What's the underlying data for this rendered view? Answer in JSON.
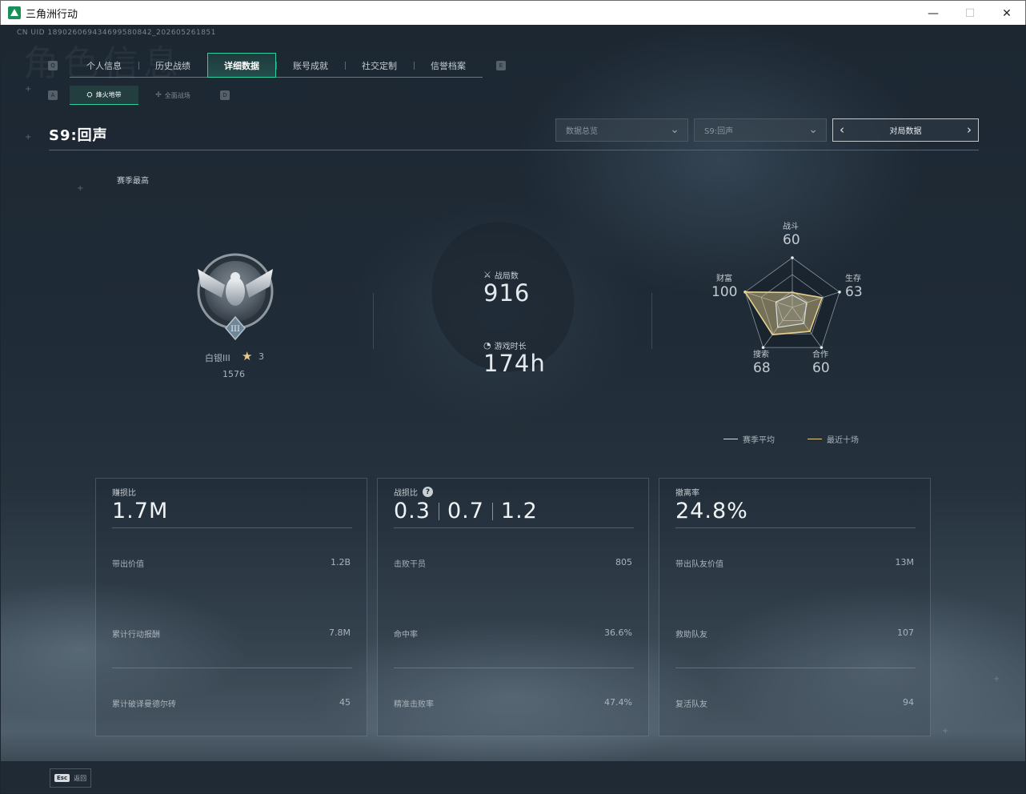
{
  "window": {
    "title": "三角洲行动",
    "minimize": "—",
    "maximize": "☐",
    "close": "✕"
  },
  "uid": "CN UID 189026069434699580842_202605261851",
  "bg_title": "角色信息",
  "tab_keys": {
    "left": "Q",
    "right": "E",
    "sub_left": "A",
    "sub_right": "D"
  },
  "tabs": [
    "个人信息",
    "历史战绩",
    "详细数据",
    "账号成就",
    "社交定制",
    "信誉档案"
  ],
  "subtabs": [
    {
      "icon": "⛭",
      "label": "烽火地带"
    },
    {
      "icon": "✢",
      "label": "全面战场"
    }
  ],
  "season_title": "S9:回声",
  "dropdowns": [
    {
      "value": "数据总览",
      "chev": "⌄"
    },
    {
      "value": "S9:回声",
      "chev": "⌄"
    }
  ],
  "pager": {
    "label": "对局数据",
    "prev": "‹",
    "next": "›"
  },
  "season_best": "赛季最高",
  "rank": {
    "name": "白银III",
    "star_icon": "★",
    "stars": "3",
    "score": "1576",
    "tier": "III"
  },
  "stats": {
    "matches": {
      "icon": "⚔",
      "label": "战局数",
      "value": "916"
    },
    "playtime": {
      "icon": "◔",
      "label": "游戏时长",
      "value": "174h"
    }
  },
  "radar": {
    "axes": [
      {
        "label": "战斗",
        "value": "60"
      },
      {
        "label": "生存",
        "value": "63"
      },
      {
        "label": "合作",
        "value": "60"
      },
      {
        "label": "搜索",
        "value": "68"
      },
      {
        "label": "财富",
        "value": "100"
      }
    ],
    "season_values": [
      0.25,
      0.3,
      0.4,
      0.5,
      0.35
    ],
    "recent_values": [
      0.3,
      0.63,
      0.6,
      0.68,
      1.0
    ],
    "colors": {
      "season": "#d8dde2",
      "recent": "#e6cf8c"
    }
  },
  "legend": {
    "season": "赛季平均",
    "recent": "最近十场"
  },
  "cards": [
    {
      "title": "赚损比",
      "big": "1.7M",
      "rows": [
        {
          "label": "带出价值",
          "value": "1.2B"
        },
        {
          "label": "累计行动报酬",
          "value": "7.8M"
        },
        {
          "label": "累计破译曼德尔砖",
          "value": "45"
        }
      ]
    },
    {
      "title": "战损比",
      "help": "?",
      "big_parts": [
        "0.3",
        "0.7",
        "1.2"
      ],
      "rows": [
        {
          "label": "击败干员",
          "value": "805"
        },
        {
          "label": "命中率",
          "value": "36.6%"
        },
        {
          "label": "精准击败率",
          "value": "47.4%"
        }
      ]
    },
    {
      "title": "撤离率",
      "big": "24.8%",
      "rows": [
        {
          "label": "带出队友价值",
          "value": "13M"
        },
        {
          "label": "救助队友",
          "value": "107"
        },
        {
          "label": "复活队友",
          "value": "94"
        }
      ]
    }
  ],
  "footer": {
    "key": "Esc",
    "label": "返回"
  }
}
